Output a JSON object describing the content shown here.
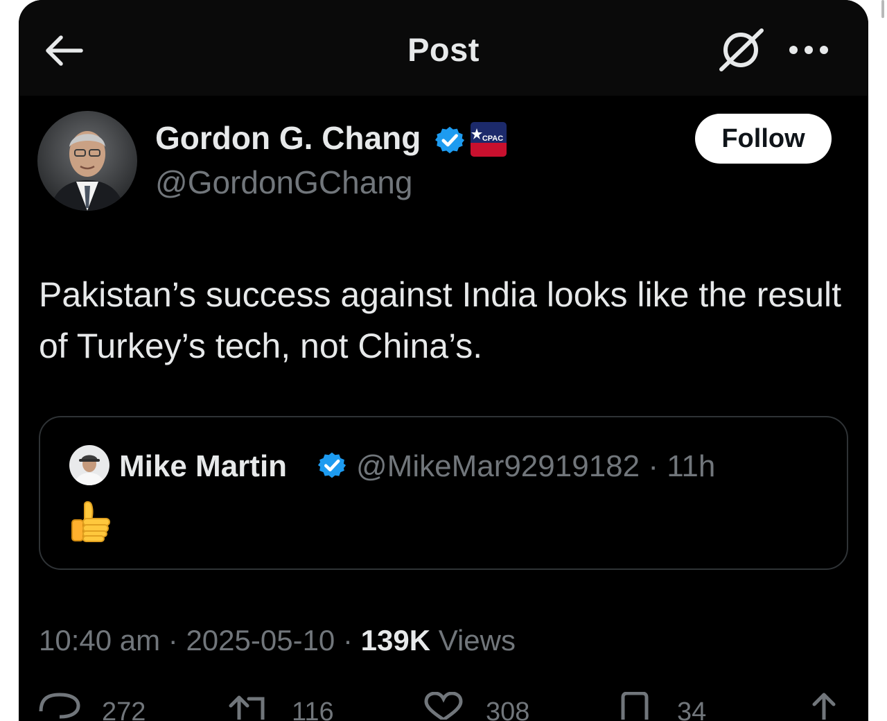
{
  "header": {
    "title": "Post",
    "back_icon": "arrow-left-icon",
    "grok_icon": "grok-icon",
    "more_icon": "more-dots-icon"
  },
  "author": {
    "name": "Gordon G. Chang",
    "handle": "@GordonGChang",
    "verified": true,
    "affiliation_badge": "CPAC",
    "follow_label": "Follow"
  },
  "tweet": {
    "text": "Pakistan’s success against India looks like the result of Turkey’s tech, not China’s."
  },
  "quote": {
    "name": "Mike Martin",
    "verified": true,
    "meta": "@MikeMar92919182 · 11h",
    "content": "👍"
  },
  "timestamp": {
    "time": "10:40 am",
    "date": "2025-05-10",
    "views_count": "139K",
    "views_label": "Views"
  },
  "actions": {
    "replies": "272",
    "reposts": "116",
    "likes": "308",
    "bookmarks": "34"
  },
  "colors": {
    "background": "#000000",
    "header_background": "#0a0a0a",
    "text_primary": "#e7e9ea",
    "text_secondary": "#71767b",
    "verified_blue": "#1d9bf0",
    "border": "#2f3336"
  }
}
